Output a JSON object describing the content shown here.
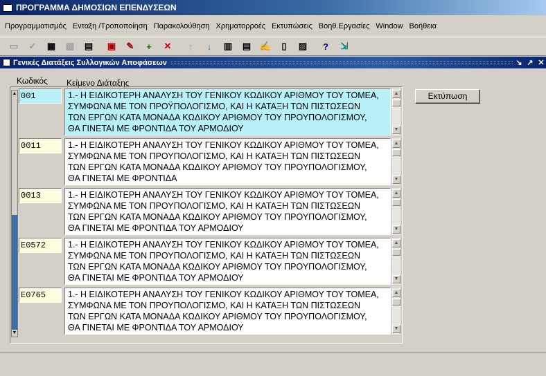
{
  "window": {
    "title": "ΠΡΟΓΡΑΜΜΑ ΔΗΜΟΣΙΩΝ ΕΠΕΝΔΥΣΕΩΝ"
  },
  "menu": [
    "Προγραμματισμός",
    "Ενταξη /Τροποποίηση",
    "Παρακολούθηση",
    "Χρηματορροές",
    "Εκτυπώσεις",
    "Βοηθ.Εργασίες",
    "Window",
    "Βοήθεια"
  ],
  "toolbar": {
    "icons": [
      "save-icon",
      "check-icon",
      "query-icon",
      "clear-query-icon",
      "records-icon",
      "insert-form-icon",
      "edit-icon",
      "add-record-icon",
      "delete-record-icon",
      "arrow-up-icon",
      "arrow-down-icon",
      "print-icon",
      "list-icon",
      "notes-icon",
      "copy-icon",
      "paste-icon",
      "help-icon",
      "exit-icon"
    ],
    "glyphs": [
      "▭",
      "✓",
      "▦",
      "▧",
      "▤",
      "▣",
      "✎",
      "+",
      "✕",
      "↑",
      "↓",
      "▥",
      "▤",
      "✍",
      "▯",
      "▨",
      "?",
      "⇲"
    ],
    "help_label": "?"
  },
  "subwindow": {
    "title": "Γενικές Διατάξεις Συλλογικών Αποφάσεων",
    "controls": [
      "↘",
      "↗",
      "✕"
    ]
  },
  "form": {
    "code_label": "Κωδικός",
    "text_label": "Κείμενο Διάταξης",
    "print_label": "Εκτύπωση",
    "records": [
      {
        "code": "001",
        "text": "1.- Η ΕΙΔΙΚΟΤΕΡΗ ΑΝΑΛΥΣΗ ΤΟΥ ΓΕΝΙΚΟΥ ΚΩΔΙΚΟΥ ΑΡΙΘΜΟΥ ΤΟΥ ΤΟΜΕΑ, ΣΥΜΦΩΝΑ ΜΕ ΤΟΝ ΠΡΟΫΠΟΛΟΓΙΣΜΟ, ΚΑΙ Η ΚΑΤΑΞΗ ΤΩΝ ΠΙΣΤΩΣΕΩΝ ΤΩΝ ΕΡΓΩΝ ΚΑΤΑ ΜΟΝΑΔΑ ΚΩΔΙΚΟΥ ΑΡΙΘΜΟΥ ΤΟΥ ΠΡΟΥΠΟΛΟΓΙΣΜΟΥ, ΘΑ ΓΙΝΕΤΑΙ ΜΕ ΦΡΟΝΤΙΔΑ ΤΟΥ ΑΡΜΟΔΙΟΥ"
      },
      {
        "code": "0011",
        "text": "1.- Η ΕΙΔΙΚΟΤΕΡΗ ΑΝΑΛΥΣΗ ΤΟΥ ΓΕΝΙΚΟΥ ΚΩΔΙΚΟΥ ΑΡΙΘΜΟΥ ΤΟΥ ΤΟΜΕΑ, ΣΥΜΦΩΝΑ ΜΕ ΤΟΝ ΠΡΟΥΠΟΛΟΓΙΣΜΟ, ΚΑΙ Η ΚΑΤΑΞΗ ΤΩΝ ΠΙΣΤΩΣΕΩΝ ΤΩΝ ΕΡΓΩΝ ΚΑΤΑ ΜΟΝΑΔΑ ΚΩΔΙΚΟΥ ΑΡΙΘΜΟΥ ΤΟΥ ΠΡΟΥΠΟΛΟΓΙΣΜΟΥ, ΘΑ ΓΙΝΕΤΑΙ ΜΕ ΦΡΟΝΤΙΔΑ"
      },
      {
        "code": "0013",
        "text": "1.- Η ΕΙΔΙΚΟΤΕΡΗ ΑΝΑΛΥΣΗ ΤΟΥ ΓΕΝΙΚΟΥ ΚΩΔΙΚΟΥ ΑΡΙΘΜΟΥ ΤΟΥ ΤΟΜΕΑ, ΣΥΜΦΩΝΑ ΜΕ ΤΟΝ ΠΡΟΥΠΟΛΟΓΙΣΜΟ, ΚΑΙ Η ΚΑΤΑΞΗ ΤΩΝ ΠΙΣΤΩΣΕΩΝ ΤΩΝ ΕΡΓΩΝ ΚΑΤΑ ΜΟΝΑΔΑ ΚΩΔΙΚΟΥ ΑΡΙΘΜΟΥ ΤΟΥ ΠΡΟΥΠΟΛΟΓΙΣΜΟΥ, ΘΑ ΓΙΝΕΤΑΙ ΜΕ ΦΡΟΝΤΙΔΑ ΤΟΥ ΑΡΜΟΔΙΟΥ"
      },
      {
        "code": "E0572",
        "text": "1.- Η ΕΙΔΙΚΟΤΕΡΗ ΑΝΑΛΥΣΗ ΤΟΥ ΓΕΝΙΚΟΥ ΚΩΔΙΚΟΥ ΑΡΙΘΜΟΥ ΤΟΥ ΤΟΜΕΑ, ΣΥΜΦΩΝΑ ΜΕ ΤΟΝ ΠΡΟΥΠΟΛΟΓΙΣΜΟ, ΚΑΙ Η ΚΑΤΑΞΗ ΤΩΝ ΠΙΣΤΩΣΕΩΝ ΤΩΝ ΕΡΓΩΝ ΚΑΤΑ ΜΟΝΑΔΑ ΚΩΔΙΚΟΥ ΑΡΙΘΜΟΥ ΤΟΥ ΠΡΟΥΠΟΛΟΓΙΣΜΟΥ, ΘΑ ΓΙΝΕΤΑΙ ΜΕ ΦΡΟΝΤΙΔΑ ΤΟΥ ΑΡΜΟΔΙΟΥ"
      },
      {
        "code": "E0765",
        "text": "1.- Η ΕΙΔΙΚΟΤΕΡΗ ΑΝΑΛΥΣΗ ΤΟΥ ΓΕΝΙΚΟΥ ΚΩΔΙΚΟΥ ΑΡΙΘΜΟΥ ΤΟΥ ΤΟΜΕΑ, ΣΥΜΦΩΝΑ ΜΕ ΤΟΝ ΠΡΟΥΠΟΛΟΓΙΣΜΟ, ΚΑΙ Η ΚΑΤΑΞΗ ΤΩΝ ΠΙΣΤΩΣΕΩΝ ΤΩΝ ΕΡΓΩΝ ΚΑΤΑ ΜΟΝΑΔΑ ΚΩΔΙΚΟΥ ΑΡΙΘΜΟΥ ΤΟΥ ΠΡΟΥΠΟΛΟΓΙΣΜΟΥ, ΘΑ ΓΙΝΕΤΑΙ ΜΕ ΦΡΟΝΤΙΔΑ ΤΟΥ ΑΡΜΟΔΙΟΥ"
      }
    ]
  },
  "colors": {
    "active_row": "#b8f0f8",
    "code_bg": "#ffffe0",
    "title_bar": "#0a246a"
  }
}
